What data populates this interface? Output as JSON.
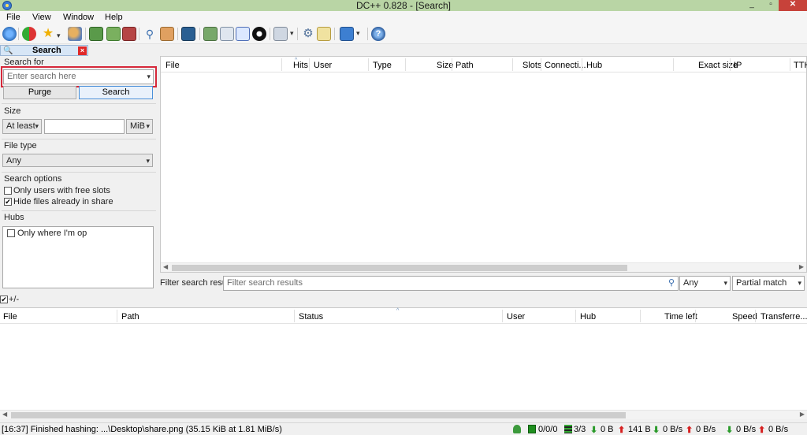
{
  "window": {
    "title": "DC++ 0.828 - [Search]",
    "minimize": "_",
    "maximize": "▫",
    "close": "✕"
  },
  "menu": {
    "file": "File",
    "view": "View",
    "window": "Window",
    "help": "Help"
  },
  "toolbar": {
    "icons": [
      "connect-icon",
      "reconnect-icon",
      "favorites-icon",
      "favorite-users-icon",
      "queue-icon",
      "finished-downloads-icon",
      "finished-uploads-icon",
      "search-icon",
      "adl-search-icon",
      "search-spy-icon",
      "open-file-list-icon",
      "open-own-list-icon",
      "match-queue-icon",
      "refresh-share-icon",
      "notepad-icon",
      "system-log-icon",
      "settings-icon",
      "hash-progress-icon",
      "plugins-icon",
      "help-icon"
    ]
  },
  "tab": {
    "label": "Search"
  },
  "search": {
    "label": "Search for",
    "placeholder": "Enter search here",
    "purge": "Purge",
    "search_button": "Search"
  },
  "size": {
    "label": "Size",
    "mode": "At least",
    "value": "",
    "unit": "MiB"
  },
  "filetype": {
    "label": "File type",
    "value": "Any"
  },
  "options": {
    "label": "Search options",
    "free_slots": "Only users with free slots",
    "hide_shared": "Hide files already in share"
  },
  "hubs": {
    "label": "Hubs",
    "only_op": "Only where I'm op"
  },
  "results": {
    "columns": [
      "File",
      "Hits",
      "User",
      "Type",
      "Size",
      "Path",
      "Slots",
      "Connecti...",
      "Hub",
      "Exact size",
      "IP",
      "TTH"
    ]
  },
  "filter": {
    "label": "Filter search results:",
    "placeholder": "Filter search results",
    "column": "Any",
    "mode": "Partial match"
  },
  "transfers": {
    "toggle": "+/-",
    "columns": [
      "File",
      "Path",
      "Status",
      "User",
      "Hub",
      "Time left",
      "Speed",
      "Transferre..."
    ]
  },
  "status": {
    "message": "[16:37] Finished hashing: ...\\Desktop\\share.png (35.15 KiB at 1.81 MiB/s)",
    "hubs": "0/0/0",
    "slots": "3/3",
    "down_total": "0 B",
    "up_total": "141 B",
    "down_speed": "0 B/s",
    "up_speed": "0 B/s",
    "down_limit": "0 B/s",
    "up_limit": "0 B/s"
  }
}
